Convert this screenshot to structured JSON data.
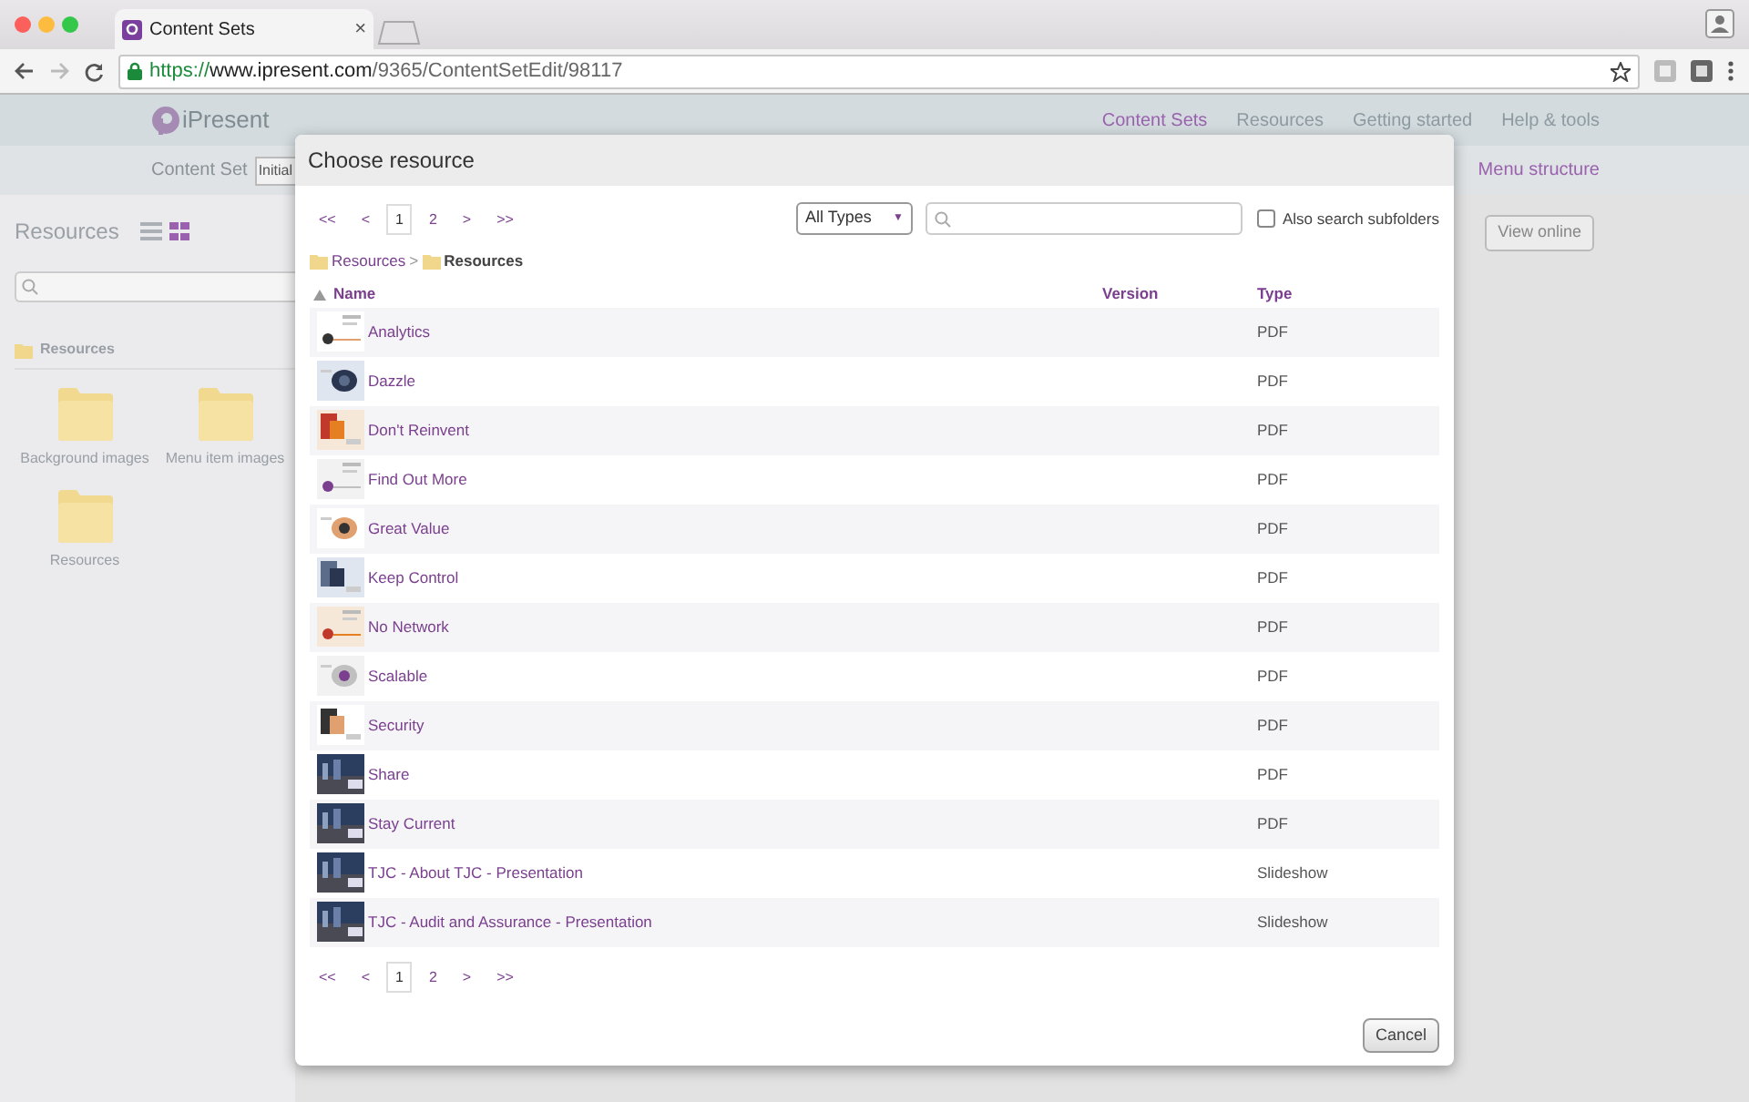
{
  "browser": {
    "tab": {
      "title": "Content Sets",
      "close": "×"
    },
    "url": {
      "scheme": "https://",
      "host": "www.ipresent.com",
      "path": "/9365/ContentSetEdit/98117"
    }
  },
  "app": {
    "logo": "iPresent",
    "nav": [
      {
        "label": "Content Sets",
        "selected": true
      },
      {
        "label": "Resources",
        "selected": false
      },
      {
        "label": "Getting started",
        "selected": false
      },
      {
        "label": "Help & tools",
        "selected": false
      }
    ],
    "subnav": {
      "label": "Content Set",
      "field_value": "Initial",
      "links": [
        "Menu structure"
      ]
    },
    "sidebar": {
      "title": "Resources",
      "views": [
        {
          "kind": "list",
          "selected": false
        },
        {
          "kind": "grid",
          "selected": true
        }
      ],
      "breadcrumb": "Resources",
      "folders": [
        "Background images",
        "Menu item images",
        "Resources"
      ]
    },
    "actions": [
      "View online"
    ]
  },
  "dialog": {
    "title": "Choose resource",
    "pager_top": [
      {
        "label": "<<",
        "selected": false
      },
      {
        "label": "<",
        "selected": false
      },
      {
        "label": "1",
        "selected": true
      },
      {
        "label": "2",
        "selected": false
      },
      {
        "label": ">",
        "selected": false
      },
      {
        "label": ">>",
        "selected": false
      }
    ],
    "type_select": "All Types",
    "type_caret": "▼",
    "breadcrumb_separator": ">",
    "subfolders": {
      "label": "Also search subfolders",
      "checked": false
    },
    "breadcrumb": [
      "Resources",
      "Resources"
    ],
    "columns": [
      {
        "label": "Name",
        "sorted": true
      },
      {
        "label": "Version",
        "sorted": false
      },
      {
        "label": "Type",
        "sorted": false
      }
    ],
    "rows": [
      {
        "name": "Analytics",
        "type": "PDF"
      },
      {
        "name": "Dazzle",
        "type": "PDF"
      },
      {
        "name": "Don't Reinvent",
        "type": "PDF"
      },
      {
        "name": "Find Out More",
        "type": "PDF"
      },
      {
        "name": "Great Value",
        "type": "PDF"
      },
      {
        "name": "Keep Control",
        "type": "PDF"
      },
      {
        "name": "No Network",
        "type": "PDF"
      },
      {
        "name": "Scalable",
        "type": "PDF"
      },
      {
        "name": "Security",
        "type": "PDF"
      },
      {
        "name": "Share",
        "type": "PDF"
      },
      {
        "name": "Stay Current",
        "type": "PDF"
      },
      {
        "name": "TJC - About TJC - Presentation",
        "type": "Slideshow"
      },
      {
        "name": "TJC - Audit and Assurance - Presentation",
        "type": "Slideshow"
      }
    ],
    "pager_bottom": [
      {
        "label": "<<",
        "selected": false
      },
      {
        "label": "<",
        "selected": false
      },
      {
        "label": "1",
        "selected": true
      },
      {
        "label": "2",
        "selected": false
      },
      {
        "label": ">",
        "selected": false
      },
      {
        "label": ">>",
        "selected": false
      }
    ],
    "cancel": "Cancel"
  }
}
